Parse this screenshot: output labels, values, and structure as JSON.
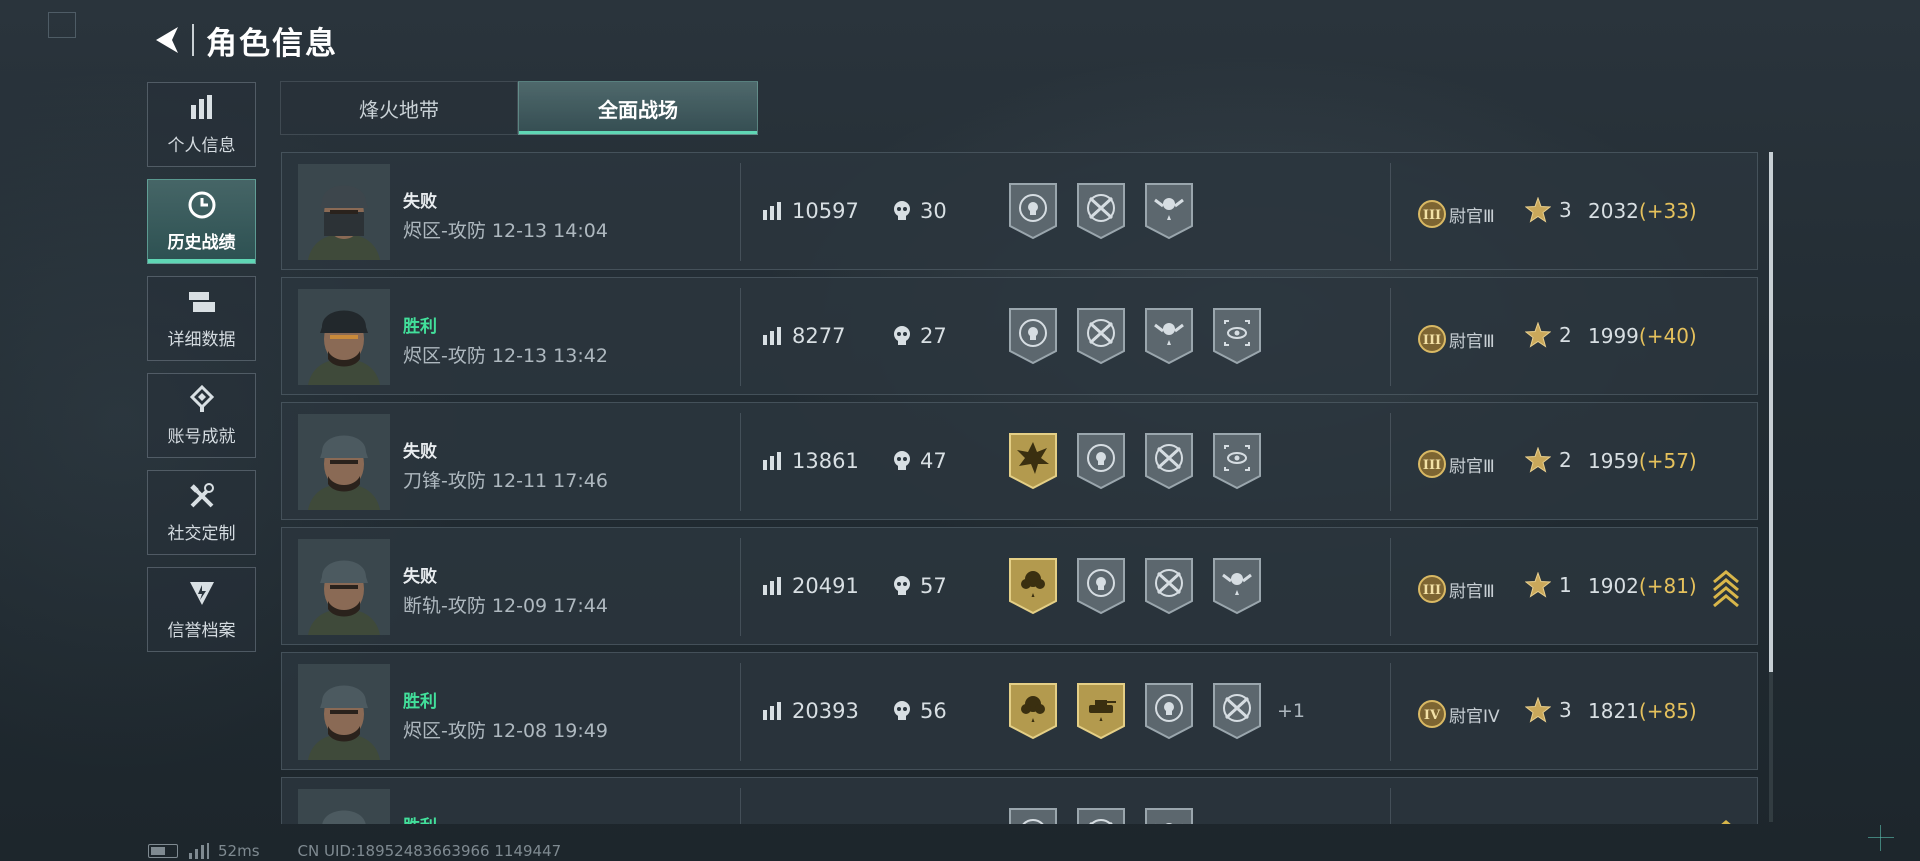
{
  "header": {
    "title": "角色信息"
  },
  "sidebar": {
    "items": [
      {
        "label": "个人信息",
        "icon": "stats-bars-icon",
        "active": false
      },
      {
        "label": "历史战绩",
        "icon": "clock-icon",
        "active": true
      },
      {
        "label": "详细数据",
        "icon": "cards-icon",
        "active": false
      },
      {
        "label": "账号成就",
        "icon": "achievement-icon",
        "active": false
      },
      {
        "label": "社交定制",
        "icon": "tools-icon",
        "active": false
      },
      {
        "label": "信誉档案",
        "icon": "credit-shield-icon",
        "active": false
      }
    ]
  },
  "tabs": [
    {
      "label": "烽火地带",
      "active": false
    },
    {
      "label": "全面战场",
      "active": true
    }
  ],
  "matches": [
    {
      "result": "失败",
      "win": false,
      "map": "烬区-攻防",
      "time": "12-13 14:04",
      "score": "10597",
      "kills": "30",
      "medals": [
        "skull-target-medal",
        "crossed-rifles-medal",
        "winged-skull-medal"
      ],
      "extra": "",
      "rank_numeral": "III",
      "rank_name": "尉官Ⅲ",
      "stars": "3",
      "points": "2032",
      "delta": "(+33)",
      "rank_up": false
    },
    {
      "result": "胜利",
      "win": true,
      "map": "烬区-攻防",
      "time": "12-13 13:42",
      "score": "8277",
      "kills": "27",
      "medals": [
        "skull-target-medal",
        "crossed-rifles-medal",
        "winged-skull-medal",
        "eye-scope-medal"
      ],
      "extra": "",
      "rank_numeral": "III",
      "rank_name": "尉官Ⅲ",
      "stars": "2",
      "points": "1999",
      "delta": "(+40)",
      "rank_up": false
    },
    {
      "result": "失败",
      "win": false,
      "map": "刀锋-攻防",
      "time": "12-11 17:46",
      "score": "13861",
      "kills": "47",
      "medals": [
        "gold-explosion-medal",
        "skull-target-medal",
        "crossed-rifles-medal",
        "eye-scope-medal"
      ],
      "extra": "",
      "rank_numeral": "III",
      "rank_name": "尉官Ⅲ",
      "stars": "2",
      "points": "1959",
      "delta": "(+57)",
      "rank_up": false
    },
    {
      "result": "失败",
      "win": false,
      "map": "断轨-攻防",
      "time": "12-09 17:44",
      "score": "20491",
      "kills": "57",
      "medals": [
        "gold-rose-medal",
        "skull-target-medal",
        "crossed-rifles-medal",
        "winged-skull-medal"
      ],
      "extra": "",
      "rank_numeral": "III",
      "rank_name": "尉官Ⅲ",
      "stars": "1",
      "points": "1902",
      "delta": "(+81)",
      "rank_up": true
    },
    {
      "result": "胜利",
      "win": true,
      "map": "烬区-攻防",
      "time": "12-08 19:49",
      "score": "20393",
      "kills": "56",
      "medals": [
        "gold-rose-medal",
        "gold-tank-medal",
        "skull-target-medal",
        "crossed-rifles-medal"
      ],
      "extra": "+1",
      "rank_numeral": "IV",
      "rank_name": "尉官IV",
      "stars": "3",
      "points": "1821",
      "delta": "(+85)",
      "rank_up": false
    },
    {
      "result": "胜利",
      "win": true,
      "map": "",
      "time": "",
      "score": "",
      "kills": "",
      "medals": [
        "skull-target-medal",
        "crossed-rifles-medal",
        "winged-skull-medal"
      ],
      "extra": "",
      "rank_numeral": "",
      "rank_name": "",
      "stars": "",
      "points": "",
      "delta": "",
      "rank_up": true
    }
  ],
  "footer": {
    "ping": "52ms",
    "uid": "CN UID:18952483663966 1149447"
  },
  "colors": {
    "accent": "#5fd6b4",
    "win": "#42e09b",
    "gold": "#e5c15c"
  }
}
